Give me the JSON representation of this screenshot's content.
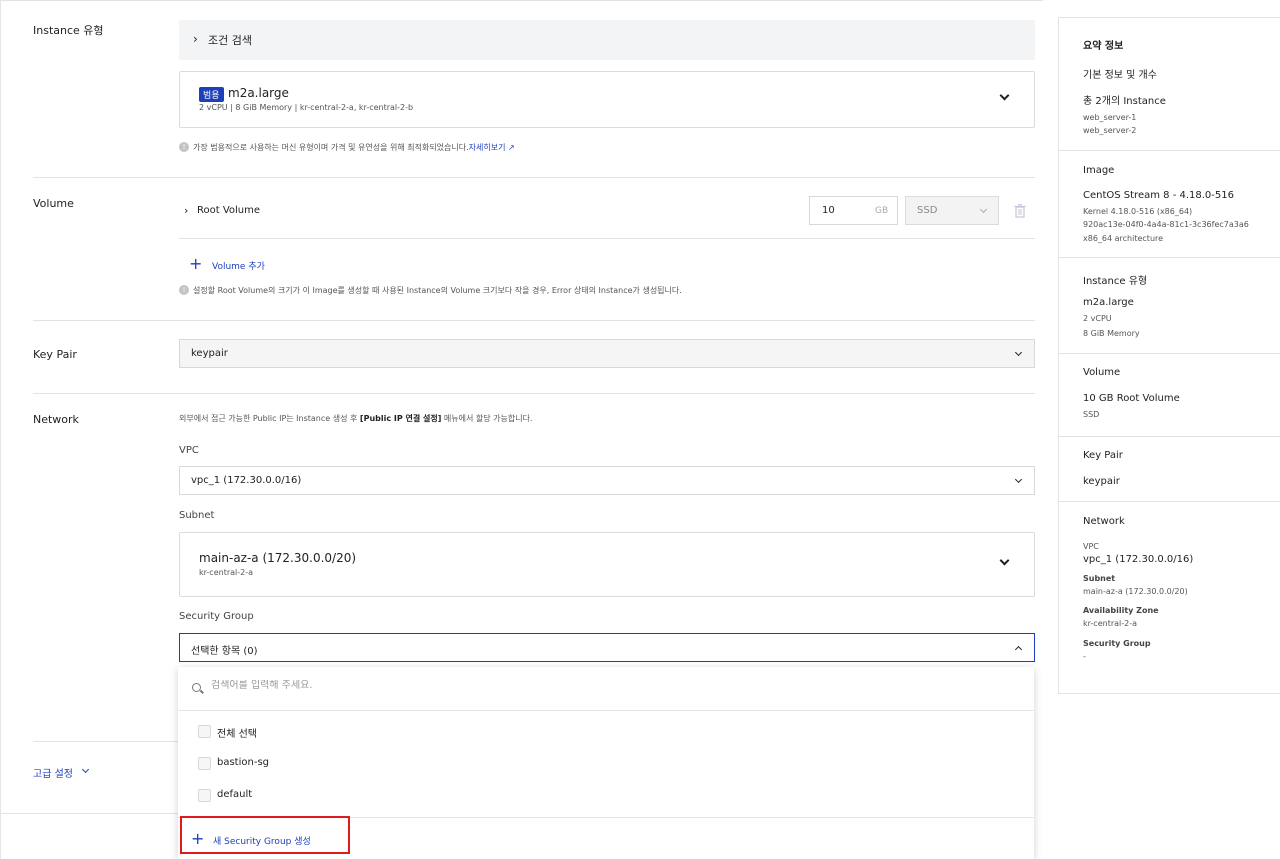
{
  "instance_type": {
    "label": "Instance 유형",
    "filter_label": "조건 검색",
    "badge": "범용",
    "name": "m2a.large",
    "spec": "2 vCPU | 8 GiB Memory | kr-central-2-a, kr-central-2-b",
    "note": "가장 범용적으로 사용하는 머신 유형이며 가격 및 유연성을 위해 최적화되었습니다.",
    "note_link": "자세히보기"
  },
  "volume": {
    "label": "Volume",
    "root_label": "Root Volume",
    "size": "10",
    "unit": "GB",
    "type": "SSD",
    "add_label": "Volume 추가",
    "note": "설정할 Root Volume의 크기가 이 Image를 생성할 때 사용된 Instance의 Volume 크기보다 작을 경우, Error 상태의 Instance가 생성됩니다."
  },
  "key_pair": {
    "label": "Key Pair",
    "value": "keypair"
  },
  "network": {
    "label": "Network",
    "note_prefix": "외부에서 접근 가능한 Public IP는 Instance 생성 후 ",
    "note_bold": "[Public IP 연결 설정]",
    "note_suffix": " 메뉴에서 할당 가능합니다.",
    "vpc_label": "VPC",
    "vpc_value": "vpc_1 (172.30.0.0/16)",
    "subnet_label": "Subnet",
    "subnet_name": "main-az-a (172.30.0.0/20)",
    "subnet_zone": "kr-central-2-a",
    "sg_label": "Security Group",
    "sg_value": "선택한 항목 (0)"
  },
  "sg_dropdown": {
    "search_placeholder": "검색어를 입력해 주세요.",
    "items": [
      "전체 선택",
      "bastion-sg",
      "default"
    ],
    "create_label": "새 Security Group 생성"
  },
  "advanced": {
    "label": "고급 설정"
  },
  "summary": {
    "title": "요약 정보",
    "basic_header": "기본 정보 및 개수",
    "basic_count": "총 2개의 Instance",
    "basic_names": [
      "web_server-1",
      "web_server-2"
    ],
    "image_header": "Image",
    "image_name": "CentOS Stream 8 - 4.18.0-516",
    "image_lines": [
      "Kernel 4.18.0-516 (x86_64)",
      "920ac13e-04f0-4a4a-81c1-3c36fec7a3a6",
      "x86_64 architecture"
    ],
    "type_header": "Instance 유형",
    "type_name": "m2a.large",
    "type_lines": [
      "2 vCPU",
      "8 GiB Memory"
    ],
    "volume_header": "Volume",
    "volume_value": "10 GB Root Volume",
    "volume_type": "SSD",
    "keypair_header": "Key Pair",
    "keypair_value": "keypair",
    "network_header": "Network",
    "vpc_label": "VPC",
    "vpc_value": "vpc_1 (172.30.0.0/16)",
    "subnet_label": "Subnet",
    "subnet_value": "main-az-a (172.30.0.0/20)",
    "az_label": "Availability Zone",
    "az_value": "kr-central-2-a",
    "sg_label": "Security Group",
    "sg_value": "-"
  },
  "colors": {
    "accent": "#1d3fbb",
    "highlight": "#e01b1b"
  }
}
